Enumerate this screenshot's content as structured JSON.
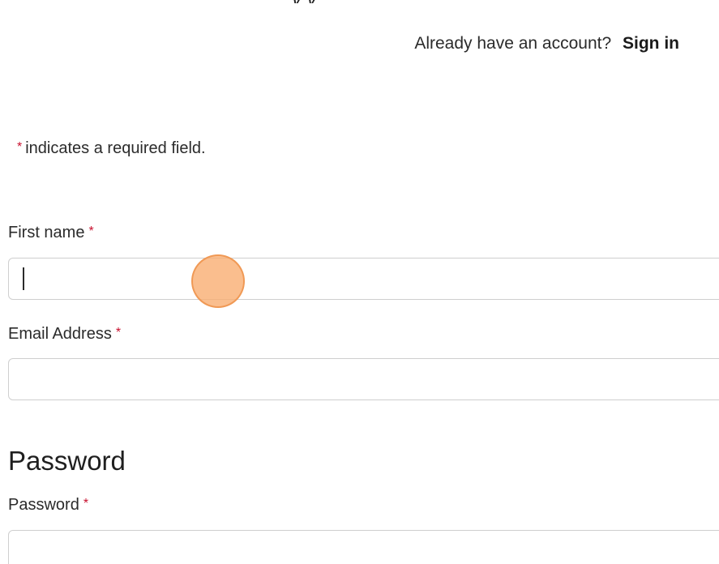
{
  "header": {
    "top_partial_text": "y     y",
    "account_prompt": "Already have an account?",
    "signin_label": "Sign in"
  },
  "form": {
    "required_asterisk": "*",
    "required_note": "indicates a required field.",
    "first_name": {
      "label": "First name",
      "asterisk": "*",
      "value": "",
      "placeholder": ""
    },
    "email": {
      "label": "Email Address",
      "asterisk": "*",
      "value": "",
      "placeholder": ""
    },
    "password_section": {
      "heading": "Password"
    },
    "password": {
      "label": "Password",
      "asterisk": "*",
      "value": "",
      "placeholder": ""
    }
  },
  "colors": {
    "required_asterisk": "#c8102e",
    "click_indicator": "#f8ac6e",
    "field_border": "#cfcfcf"
  },
  "icons": {
    "click_indicator": "click-indicator-circle",
    "text_caret": "text-caret"
  }
}
